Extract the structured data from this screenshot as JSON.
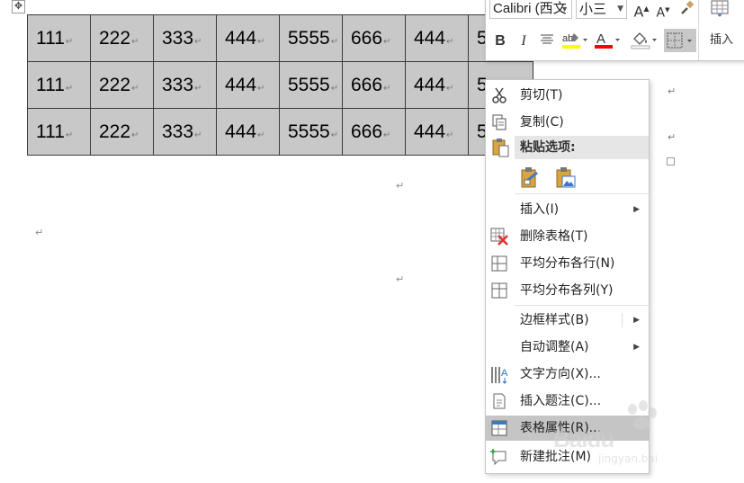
{
  "table": {
    "rows": [
      [
        "111",
        "222",
        "333",
        "444",
        "5555",
        "666",
        "444",
        "5"
      ],
      [
        "111",
        "222",
        "333",
        "444",
        "5555",
        "666",
        "444",
        "5"
      ],
      [
        "111",
        "222",
        "333",
        "444",
        "5555",
        "666",
        "444",
        "5"
      ]
    ]
  },
  "toolbar": {
    "font_name": "Calibri (西文",
    "font_size": "小三",
    "bold": "B",
    "italic": "I",
    "font_color_letter": "A",
    "insert_label": "插入",
    "colors": {
      "highlight": "#ffff00",
      "font_color": "#ff0000"
    }
  },
  "menu": {
    "cut": "剪切(T)",
    "copy": "复制(C)",
    "paste_options": "粘贴选项:",
    "insert": "插入(I)",
    "delete_table": "删除表格(T)",
    "distribute_rows": "平均分布各行(N)",
    "distribute_cols": "平均分布各列(Y)",
    "border_styles": "边框样式(B)",
    "autofit": "自动调整(A)",
    "text_direction": "文字方向(X)...",
    "insert_caption": "插入题注(C)...",
    "table_properties": "表格属性(R)...",
    "new_comment": "新建批注(M)"
  },
  "watermark": {
    "brand": "Baidu",
    "sub": "jingyan.bai"
  },
  "colors": {
    "menu_highlight": "#c5c5c5",
    "cell_bg": "#c8c8c8"
  }
}
